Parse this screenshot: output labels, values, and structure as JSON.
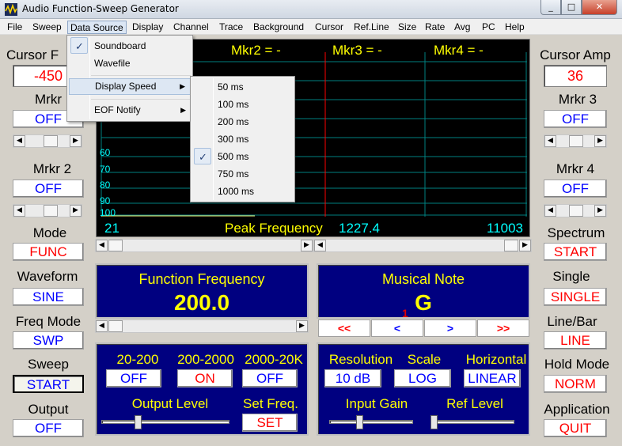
{
  "window": {
    "title": "Audio Function-Sweep Generator",
    "btn_min": "_",
    "btn_max": "□",
    "btn_close": "✕"
  },
  "menu": {
    "items": [
      "File",
      "Sweep",
      "Data Source",
      "Display",
      "Channel",
      "Trace",
      "Background",
      "Cursor",
      "Ref.Line",
      "Size",
      "Rate",
      "Avg",
      "PC",
      "Help"
    ],
    "active": "Data Source"
  },
  "data_source_menu": {
    "items": [
      {
        "label": "Soundboard",
        "checked": true
      },
      {
        "label": "Wavefile",
        "checked": false
      },
      {
        "label": "Display Speed",
        "submenu": true,
        "highlighted": true
      },
      {
        "label": "EOF Notify",
        "submenu": true
      }
    ],
    "check_glyph": "✓",
    "arrow_glyph": "▶"
  },
  "display_speed_menu": {
    "items": [
      {
        "label": "50 ms"
      },
      {
        "label": "100 ms"
      },
      {
        "label": "200 ms"
      },
      {
        "label": "300 ms"
      },
      {
        "label": "500 ms",
        "checked": true
      },
      {
        "label": "750 ms"
      },
      {
        "label": "1000 ms"
      }
    ]
  },
  "left": {
    "cursor_label": "Cursor F",
    "cursor_value": "-450",
    "mkr1_label": "Mrkr",
    "mkr1_btn": "OFF",
    "mkr2_label": "Mrkr 2",
    "mkr2_btn": "OFF",
    "mode_label": "Mode",
    "mode_btn": "FUNC",
    "waveform_label": "Waveform",
    "waveform_btn": "SINE",
    "freqmode_label": "Freq Mode",
    "freqmode_btn": "SWP",
    "sweep_label": "Sweep",
    "sweep_btn": "START",
    "output_label": "Output",
    "output_btn": "OFF"
  },
  "right": {
    "cursor_amp_label": "Cursor Amp",
    "cursor_amp_value": "36",
    "mkr3_label": "Mrkr 3",
    "mkr3_btn": "OFF",
    "mkr4_label": "Mrkr 4",
    "mkr4_btn": "OFF",
    "spectrum_label": "Spectrum",
    "spectrum_btn": "START",
    "single_label": "Single",
    "single_btn": "SINGLE",
    "linebar_label": "Line/Bar",
    "linebar_btn": "LINE",
    "hold_label": "Hold Mode",
    "hold_btn": "NORM",
    "app_label": "Application",
    "app_btn": "QUIT"
  },
  "graph": {
    "mkr2": "Mkr2 = -",
    "mkr3": "Mkr3 = -",
    "mkr4": "Mkr4 = -",
    "y_labels": [
      "60",
      "70",
      "80",
      "90",
      "100"
    ],
    "x_left": "21",
    "x_right": "11003",
    "peak_label": "Peak Frequency",
    "peak_value": "1227.4",
    "grid_color": "#008080",
    "cursor_color": "#ff0000"
  },
  "function_panel": {
    "title": "Function Frequency",
    "value": "200.0"
  },
  "note_panel": {
    "title": "Musical Note",
    "value": "G",
    "marker": "1",
    "nav": [
      "<<",
      "<",
      ">",
      ">>"
    ]
  },
  "range_panel": {
    "r1_label": "20-200",
    "r1_btn": "OFF",
    "r2_label": "200-2000",
    "r2_btn": "ON",
    "r3_label": "2000-20K",
    "r3_btn": "OFF",
    "output_level_label": "Output Level",
    "set_freq_label": "Set Freq.",
    "set_btn": "SET"
  },
  "input_panel": {
    "resolution_label": "Resolution",
    "resolution_btn": "10 dB",
    "scale_label": "Scale",
    "scale_btn": "LOG",
    "horizontal_label": "Horizontal",
    "horizontal_btn": "LINEAR",
    "input_gain_label": "Input Gain",
    "ref_level_label": "Ref Level"
  },
  "scroll": {
    "left_arrow": "◀",
    "right_arrow": "▶"
  }
}
